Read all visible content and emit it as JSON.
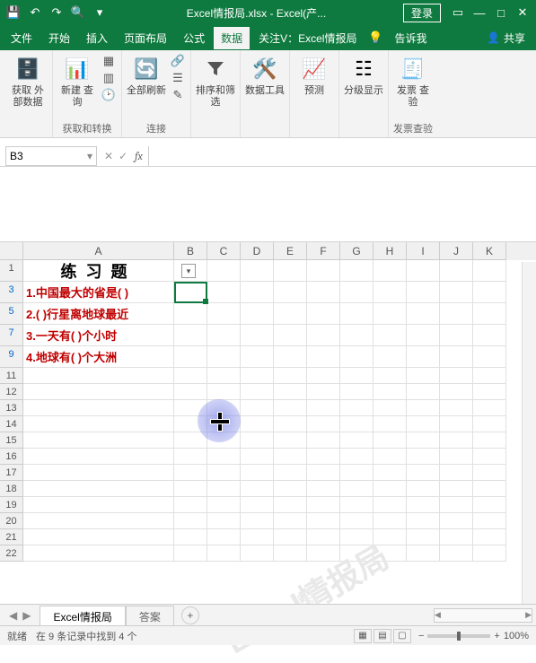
{
  "title": {
    "filename": "Excel情报局.xlsx",
    "app": "Excel(产...",
    "login": "登录"
  },
  "qat": {
    "save": "💾",
    "undo": "↶",
    "redo": "↷",
    "preview": "🔍"
  },
  "menu": [
    "文件",
    "开始",
    "插入",
    "页面布局",
    "公式",
    "数据",
    "关注V：Excel情报局",
    "告诉我",
    "共享"
  ],
  "active_menu": 5,
  "ribbon": {
    "g1": {
      "btn": "获取\n外部数据",
      "name": ""
    },
    "g2": {
      "btn": "新建\n查询",
      "name": "获取和转换"
    },
    "g3": {
      "btn": "全部刷新",
      "name": "连接"
    },
    "g4": {
      "btn": "排序和筛选",
      "name": ""
    },
    "g5": {
      "btn": "数据工具",
      "name": ""
    },
    "g6": {
      "btn": "预测",
      "name": ""
    },
    "g7": {
      "btn": "分级显示",
      "name": ""
    },
    "g8": {
      "btn": "发票\n查验",
      "name": "发票查验"
    }
  },
  "namebox": "B3",
  "columns": [
    "A",
    "B",
    "C",
    "D",
    "E",
    "F",
    "G",
    "H",
    "I",
    "J",
    "K"
  ],
  "rows": [
    "1",
    "3",
    "5",
    "7",
    "9",
    "11",
    "12",
    "13",
    "14",
    "15",
    "16",
    "17",
    "18",
    "19",
    "20",
    "21",
    "22"
  ],
  "blue_rows": [
    1,
    2,
    3,
    4
  ],
  "cells": {
    "A1": "练习题",
    "A3": "1.中国最大的省是(  )",
    "A5": "2.(  )行星离地球最近",
    "A7": "3.一天有(  )个小时",
    "A9": "4.地球有(  )个大洲"
  },
  "tabs": {
    "active": "Excel情报局",
    "other": "答案"
  },
  "status": {
    "mode": "就绪",
    "filter": "在 9 条记录中找到 4 个",
    "zoom": "100%"
  },
  "watermark": "Excel情报局"
}
